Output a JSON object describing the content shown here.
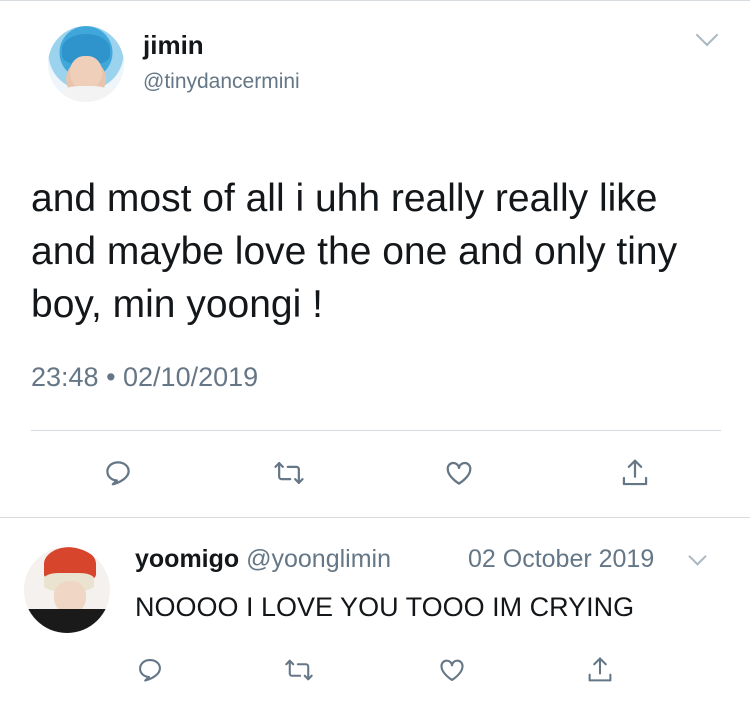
{
  "tweet": {
    "name": "jimin",
    "handle": "@tinydancermini",
    "text": "and most of all i uhh really really like and maybe love the one and only tiny boy, min yoongi !",
    "timestamp": "23:48 • 02/10/2019",
    "actions": [
      "reply-icon",
      "retweet-icon",
      "like-icon",
      "share-icon"
    ]
  },
  "reply": {
    "name": "yoomigo",
    "handle": "@yoonglimin",
    "date": "02 October 2019",
    "text": "NOOOO I LOVE YOU TOOO IM CRYING",
    "actions": [
      "reply-icon",
      "retweet-icon",
      "like-icon",
      "share-icon"
    ]
  },
  "colors": {
    "text": "#14171a",
    "secondary": "#657786",
    "icon": "#657786",
    "divider": "#d6dbdf"
  }
}
